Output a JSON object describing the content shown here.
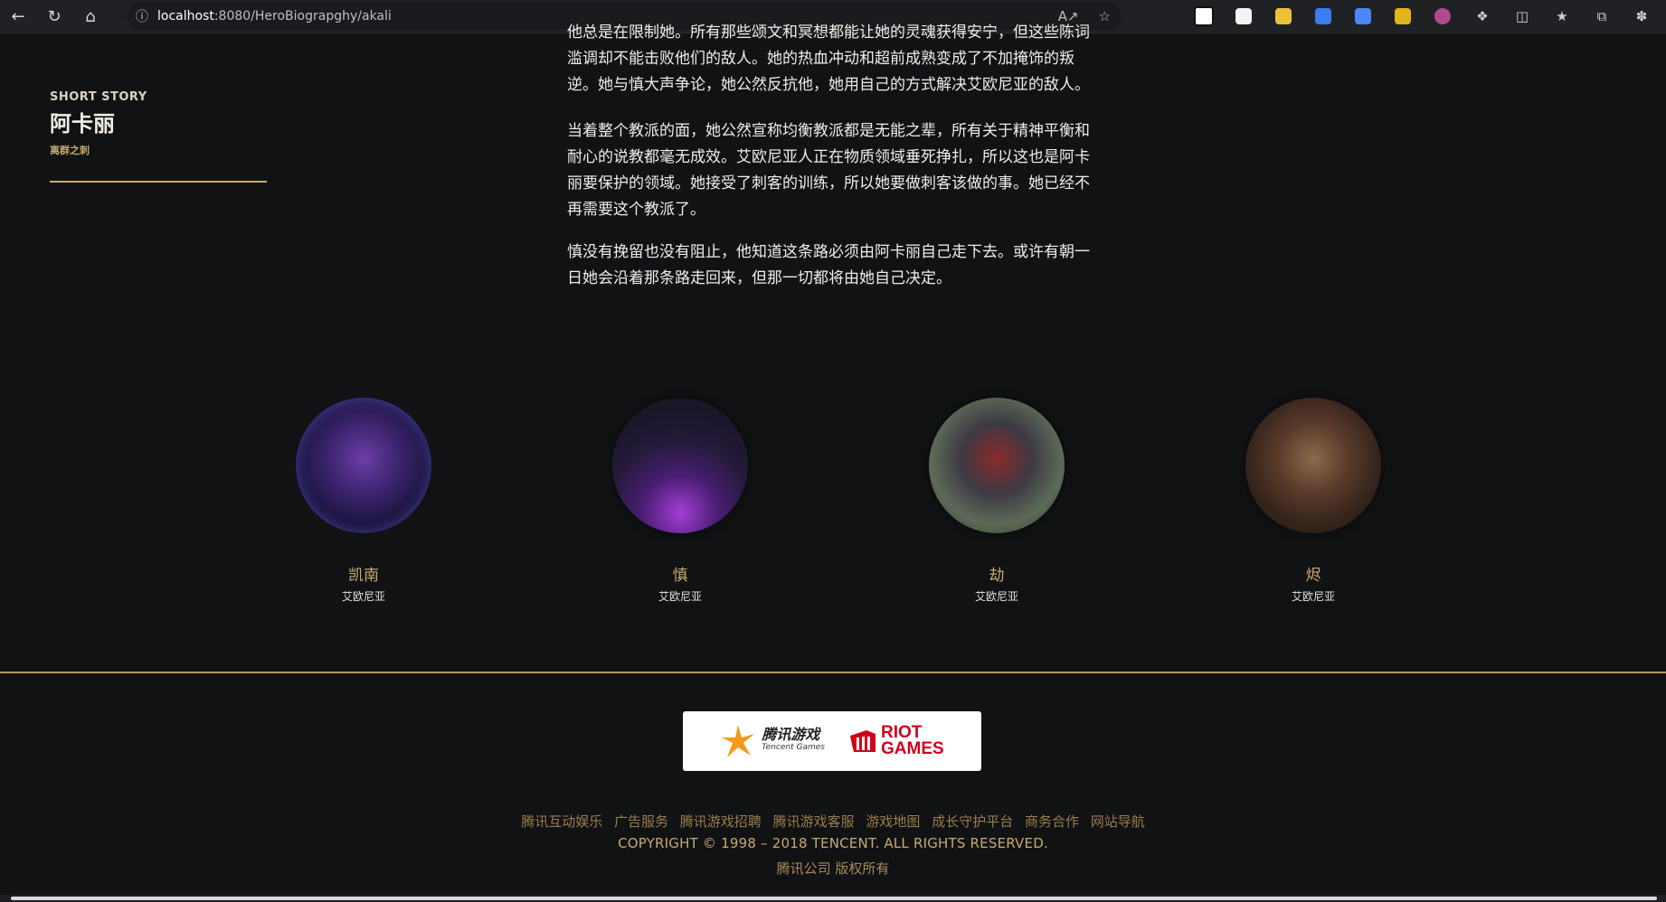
{
  "browser": {
    "url_host": "localhost",
    "url_rest": ":8080/HeroBiograpghy/akali",
    "icons": [
      "back-icon",
      "refresh-icon",
      "home-icon",
      "info-icon",
      "read-aloud-icon",
      "favorite-star-icon",
      "split-screen-icon",
      "favorites-icon",
      "collections-icon",
      "extensions-icon"
    ]
  },
  "sidebar": {
    "kicker": "SHORT STORY",
    "name": "阿卡丽",
    "subtitle": "离群之刺"
  },
  "story": {
    "paragraphs": [
      "他总是在限制她。所有那些颂文和冥想都能让她的灵魂获得安宁，但这些陈词滥调却不能击败他们的敌人。她的热血冲动和超前成熟变成了不加掩饰的叛逆。她与慎大声争论，她公然反抗他，她用自己的方式解决艾欧尼亚的敌人。",
      "当着整个教派的面，她公然宣称均衡教派都是无能之辈，所有关于精神平衡和耐心的说教都毫无成效。艾欧尼亚人正在物质领域垂死挣扎，所以这也是阿卡丽要保护的领域。她接受了刺客的训练，所以她要做刺客该做的事。她已经不再需要这个教派了。",
      "慎没有挽留也没有阻止，他知道这条路必须由阿卡丽自己走下去。或许有朝一日她会沿着那条路走回来，但那一切都将由她自己决定。"
    ]
  },
  "related": [
    {
      "name": "凯南",
      "region": "艾欧尼亚"
    },
    {
      "name": "慎",
      "region": "艾欧尼亚"
    },
    {
      "name": "劫",
      "region": "艾欧尼亚"
    },
    {
      "name": "烬",
      "region": "艾欧尼亚"
    }
  ],
  "footer": {
    "logo_tencent_cn": "腾讯游戏",
    "logo_tencent_en": "Tencent Games",
    "logo_riot_top": "RIOT",
    "logo_riot_bottom": "GAMES",
    "links": [
      "腾讯互动娱乐",
      "广告服务",
      "腾讯游戏招聘",
      "腾讯游戏客服",
      "游戏地图",
      "成长守护平台",
      "商务合作",
      "网站导航"
    ],
    "copyright": "COPYRIGHT © 1998 – 2018 TENCENT. ALL RIGHTS RESERVED.",
    "company": "腾讯公司 版权所有"
  },
  "colors": {
    "background": "#111214",
    "accent_gold": "#c8aa6e",
    "link_gold": "#9a7d4c",
    "riot_red": "#d0021b"
  }
}
